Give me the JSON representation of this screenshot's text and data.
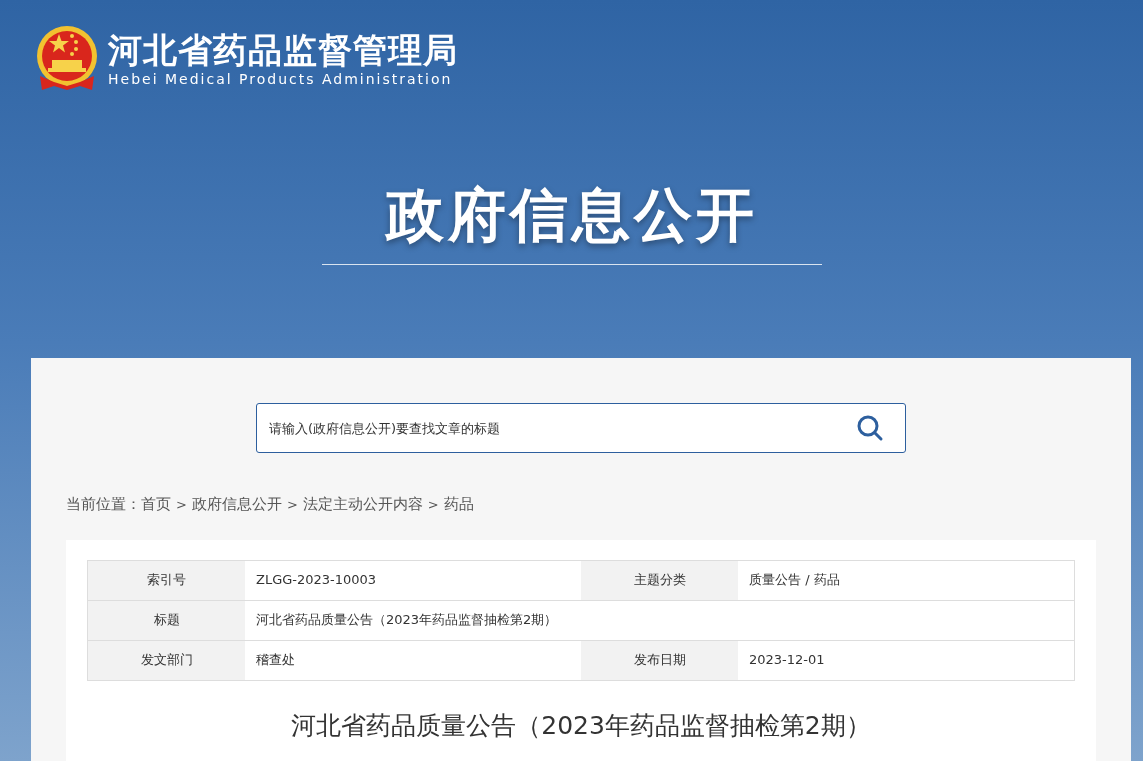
{
  "header": {
    "org_name": "河北省药品监督管理局",
    "org_name_en": "Hebei Medical Products Administration",
    "section_title": "政府信息公开"
  },
  "search": {
    "placeholder": "请输入(政府信息公开)要查找文章的标题"
  },
  "breadcrumb": {
    "label": "当前位置：",
    "separator": ">",
    "items": [
      "首页",
      "政府信息公开",
      "法定主动公开内容",
      "药品"
    ]
  },
  "info_table": {
    "rows": [
      [
        {
          "label": "索引号",
          "value": "ZLGG-2023-10003"
        },
        {
          "label": "主题分类",
          "value": "质量公告 / 药品"
        }
      ],
      [
        {
          "label": "标题",
          "value": "河北省药品质量公告（2023年药品监督抽检第2期）"
        }
      ],
      [
        {
          "label": "发文部门",
          "value": "稽查处"
        },
        {
          "label": "发布日期",
          "value": "2023-12-01"
        }
      ]
    ]
  },
  "article": {
    "title": "河北省药品质量公告（2023年药品监督抽检第2期）"
  }
}
